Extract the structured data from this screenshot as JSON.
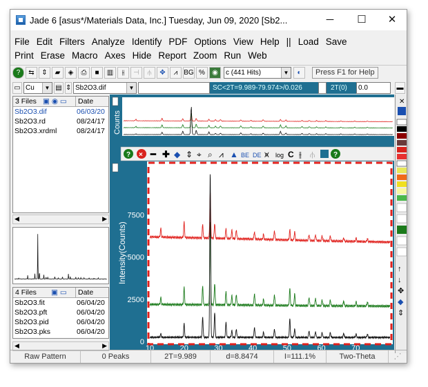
{
  "window": {
    "title": "Jade 6 [asus*/Materials Data, Inc.] Tuesday, Jun 09, 2020 [Sb2...",
    "minimize": "─",
    "maximize": "☐",
    "close": "✕"
  },
  "menu_row1": [
    "File",
    "Edit",
    "Filters",
    "Analyze",
    "Identify",
    "PDF",
    "Options",
    "View",
    "Help",
    "||",
    "Load",
    "Save"
  ],
  "menu_row2": [
    "Print",
    "Erase",
    "Macro",
    "Axes",
    "Hide",
    "Report",
    "Zoom",
    "Run",
    "Web"
  ],
  "toolbar": {
    "range_select": "c (441 Hits)",
    "hint": "Press F1 for Help",
    "element_select": "Cu",
    "file_select": "Sb2O3.dif",
    "sc_status": "SC<2T=9.989-79.974>/0.026",
    "two_theta_label": "2T(0)",
    "two_theta_value": "0.0"
  },
  "files_top": {
    "count": "3 Files",
    "date_header": "Date",
    "rows": [
      {
        "name": "Sb2O3.dif",
        "date": "06/03/20"
      },
      {
        "name": "Sb2O3.rd",
        "date": "08/24/17"
      },
      {
        "name": "Sb2O3.xrdml",
        "date": "08/24/17"
      }
    ]
  },
  "files_bottom": {
    "count": "4 Files",
    "date_header": "Date",
    "rows": [
      {
        "name": "Sb2O3.fit",
        "date": "06/04/20"
      },
      {
        "name": "Sb2O3.pft",
        "date": "06/04/20"
      },
      {
        "name": "Sb2O3.pid",
        "date": "06/04/20"
      },
      {
        "name": "Sb2O3.pks",
        "date": "06/04/20"
      }
    ]
  },
  "plot": {
    "overview_ylabel": "Counts",
    "ylabel": "Intensity(Counts)",
    "highlight_color": "#e0201c",
    "chart_data": {
      "type": "line",
      "ylabel": "Intensity(Counts)",
      "xlim": [
        10,
        80
      ],
      "ylim": [
        0,
        10500
      ],
      "x_ticks": [
        10,
        20,
        30,
        40,
        50,
        60,
        70
      ],
      "y_ticks": [
        0,
        2500,
        5000,
        7500
      ],
      "series": [
        {
          "color": "#e0201c",
          "baseline": 6200,
          "peaks": [
            [
              13.2,
              500
            ],
            [
              20.0,
              900
            ],
            [
              25.4,
              800
            ],
            [
              27.6,
              2700
            ],
            [
              28.9,
              900
            ],
            [
              32.2,
              600
            ],
            [
              33.9,
              500
            ],
            [
              35.2,
              550
            ],
            [
              40.5,
              450
            ],
            [
              43.1,
              300
            ],
            [
              46.3,
              550
            ],
            [
              50.8,
              600
            ],
            [
              52.2,
              500
            ],
            [
              56.4,
              350
            ],
            [
              58.3,
              350
            ],
            [
              60.2,
              300
            ],
            [
              62.6,
              300
            ],
            [
              66.5,
              200
            ],
            [
              70.1,
              200
            ],
            [
              73.4,
              200
            ]
          ]
        },
        {
          "color": "#1a7a1a",
          "baseline": 2200,
          "peaks": [
            [
              13.2,
              400
            ],
            [
              20.0,
              1000
            ],
            [
              25.4,
              1100
            ],
            [
              27.6,
              5000
            ],
            [
              28.9,
              1300
            ],
            [
              32.2,
              800
            ],
            [
              33.9,
              550
            ],
            [
              35.2,
              650
            ],
            [
              40.5,
              700
            ],
            [
              43.1,
              350
            ],
            [
              46.3,
              650
            ],
            [
              50.8,
              1000
            ],
            [
              52.2,
              700
            ],
            [
              56.4,
              500
            ],
            [
              58.3,
              450
            ],
            [
              60.2,
              350
            ],
            [
              62.6,
              350
            ],
            [
              66.5,
              300
            ],
            [
              70.1,
              250
            ],
            [
              73.4,
              250
            ]
          ]
        },
        {
          "color": "#111111",
          "baseline": 250,
          "peaks": [
            [
              13.2,
              200
            ],
            [
              20.0,
              800
            ],
            [
              25.4,
              1200
            ],
            [
              27.6,
              9800
            ],
            [
              28.9,
              1500
            ],
            [
              32.2,
              900
            ],
            [
              33.9,
              400
            ],
            [
              35.2,
              500
            ],
            [
              40.5,
              600
            ],
            [
              43.1,
              300
            ],
            [
              46.3,
              500
            ],
            [
              50.8,
              1100
            ],
            [
              52.2,
              500
            ],
            [
              56.4,
              400
            ],
            [
              58.3,
              350
            ],
            [
              60.2,
              300
            ],
            [
              62.6,
              300
            ],
            [
              66.5,
              250
            ],
            [
              70.1,
              200
            ],
            [
              73.4,
              200
            ]
          ]
        }
      ]
    }
  },
  "status": {
    "raw_pattern": "Raw Pattern",
    "peaks": "0 Peaks",
    "two_theta": "2T=9.989",
    "d_value": "d=8.8474",
    "intensity": "I=111.1%",
    "axis_mode": "Two-Theta"
  }
}
